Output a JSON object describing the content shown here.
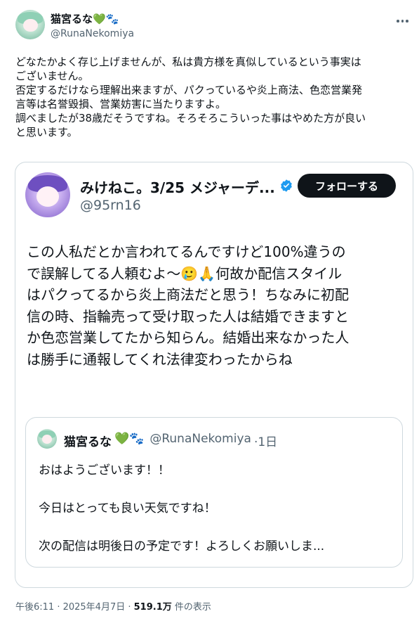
{
  "post": {
    "author_name": "猫宮るな",
    "author_emoji": "💚🐾",
    "author_handle": "@RunaNekomiya",
    "more_icon": "more-horizontal-icon",
    "text": "どなたかよく存じ上げませんが、私は貴方様を真似しているという事実は\nございません。\n否定するだけなら理解出来ますが、パクっているや炎上商法、色恋営業発\n言等は名誉毀損、営業妨害に当たりますよ。\n調べましたが38歳だそうですね。そろそろこういった事はやめた方が良い\nと思います。",
    "timestamp": "午後6:11 · 2025年4月7日 · ",
    "views_value": "519.1万",
    "views_label": " 件の表示"
  },
  "quoted": {
    "author_name": "みけねこ。3/25 メジャーデ...",
    "verified_icon": "verified-badge-icon",
    "author_handle": "@95rn16",
    "follow_label": "フォローする",
    "text": "この人私だとか言われてるんですけど100%違うの\nで誤解してる人頼むよ〜🥲🙏何故か配信スタイル\nはパクってるから炎上商法だと思う！ちなみに初配\n信の時、指輪売って受け取った人は結婚できますと\nか色恋営業してたから知らん。結婚出来なかった人\nは勝手に通報してくれ法律変わったからね"
  },
  "nested": {
    "author_name": "猫宮るな",
    "author_emoji": "💚🐾",
    "author_handle": "@RunaNekomiya",
    "time": "·1日",
    "lines": [
      "おはようございます！！",
      "今日はとっても良い天気ですね！",
      "次の配信は明後日の予定です！よろしくお願いしま..."
    ]
  },
  "colors": {
    "text": "#0f1419",
    "muted": "#536471",
    "border": "#cfd9de",
    "verified": "#1d9bf0"
  }
}
